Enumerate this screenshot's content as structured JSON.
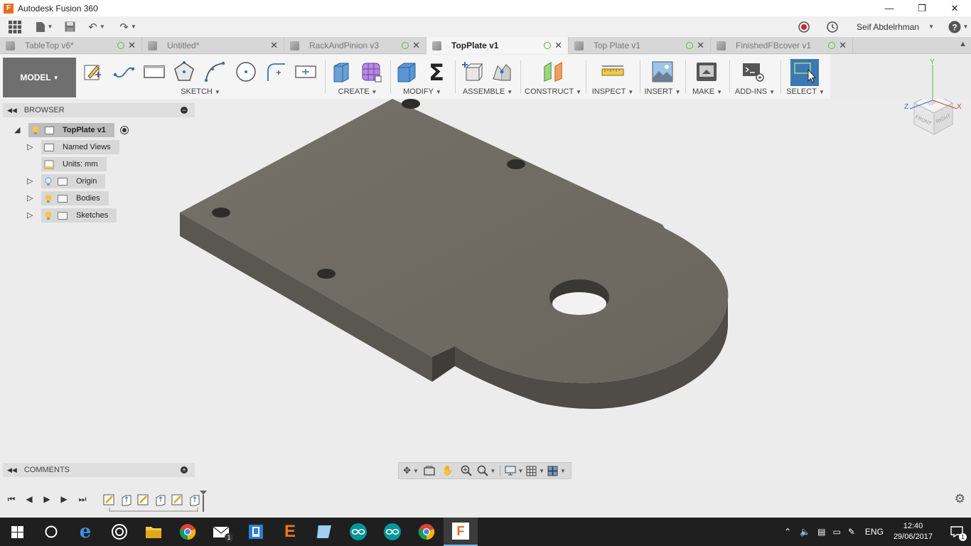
{
  "window": {
    "title": "Autodesk Fusion 360",
    "app_icon": "F"
  },
  "quick_access": {
    "user_name": "Seif Abdelrhman"
  },
  "tabs": [
    {
      "label": "TableTop v6*",
      "active": false
    },
    {
      "label": "Untitled*",
      "active": false
    },
    {
      "label": "RackAndPinion v3",
      "active": false
    },
    {
      "label": "TopPlate v1",
      "active": true
    },
    {
      "label": "Top Plate v1",
      "active": false
    },
    {
      "label": "FinishedFBcover v1",
      "active": false
    }
  ],
  "ribbon": {
    "workspace": "MODEL",
    "groups": {
      "sketch": "SKETCH",
      "create": "CREATE",
      "modify": "MODIFY",
      "assemble": "ASSEMBLE",
      "construct": "CONSTRUCT",
      "inspect": "INSPECT",
      "insert": "INSERT",
      "make": "MAKE",
      "addins": "ADD-INS",
      "select": "SELECT"
    }
  },
  "viewcube": {
    "top": "TOP",
    "front": "FRONT",
    "right": "RIGHT",
    "axis_x": "X",
    "axis_y": "Y",
    "axis_z": "Z"
  },
  "browser": {
    "header": "BROWSER",
    "root": "TopPlate v1",
    "items": [
      {
        "label": "Named Views"
      },
      {
        "label": "Units: mm"
      },
      {
        "label": "Origin"
      },
      {
        "label": "Bodies"
      },
      {
        "label": "Sketches"
      }
    ]
  },
  "comments": {
    "header": "COMMENTS"
  },
  "taskbar": {
    "language": "ENG",
    "time": "12:40",
    "date": "29/06/2017",
    "mail_badge": "1",
    "notification_badge": "1"
  },
  "colors": {
    "body_top": "#6f6b63",
    "body_side": "#55524c",
    "accent_select": "#3c78b4",
    "fusion_orange": "#e86d1f"
  }
}
